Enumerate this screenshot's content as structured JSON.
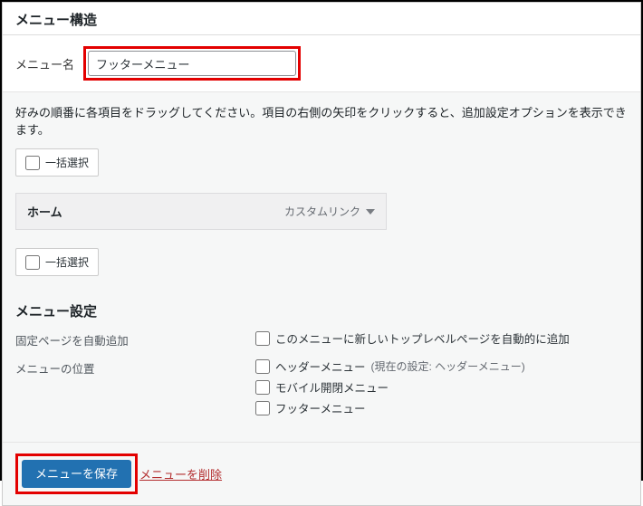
{
  "panel": {
    "title": "メニュー構造",
    "menu_name_label": "メニュー名",
    "menu_name_value": "フッターメニュー",
    "help_text": "好みの順番に各項目をドラッグしてください。項目の右側の矢印をクリックすると、追加設定オプションを表示できます。",
    "bulk_select_label": "一括選択"
  },
  "menu_items": [
    {
      "title": "ホーム",
      "type": "カスタムリンク"
    }
  ],
  "settings": {
    "heading": "メニュー設定",
    "auto_add_label": "固定ページを自動追加",
    "auto_add_option": "このメニューに新しいトップレベルページを自動的に追加",
    "location_label": "メニューの位置",
    "locations": [
      {
        "label": "ヘッダーメニュー",
        "hint": "(現在の設定: ヘッダーメニュー)"
      },
      {
        "label": "モバイル開閉メニュー",
        "hint": ""
      },
      {
        "label": "フッターメニュー",
        "hint": ""
      }
    ]
  },
  "actions": {
    "save_label": "メニューを保存",
    "delete_label": "メニューを削除"
  }
}
